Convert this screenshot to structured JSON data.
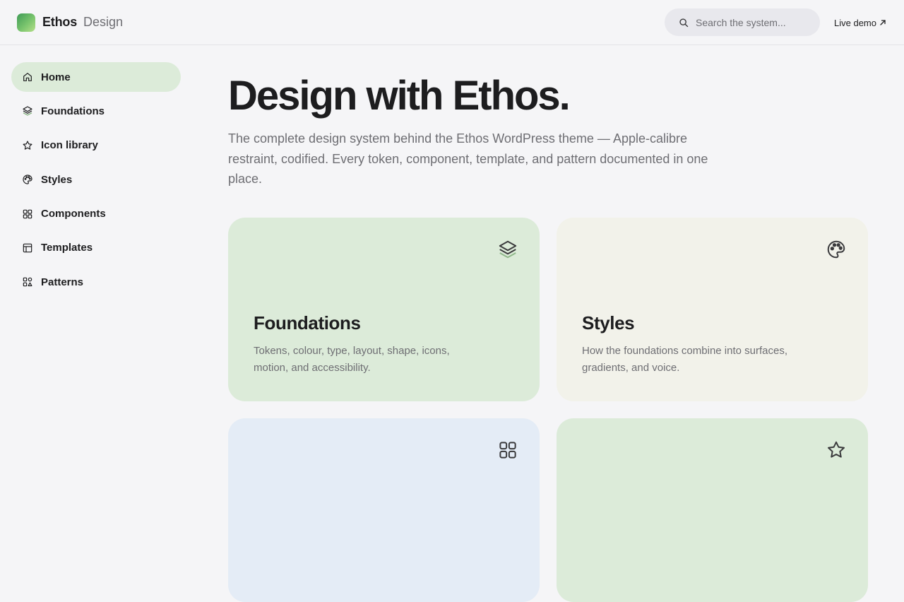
{
  "header": {
    "brand_name": "Ethos",
    "brand_sub": "Design",
    "search_placeholder": "Search the system...",
    "live_demo_label": "Live demo"
  },
  "sidebar": {
    "items": [
      {
        "label": "Home",
        "icon": "home-icon",
        "active": true
      },
      {
        "label": "Foundations",
        "icon": "layers-icon"
      },
      {
        "label": "Icon library",
        "icon": "star-icon"
      },
      {
        "label": "Styles",
        "icon": "palette-icon"
      },
      {
        "label": "Components",
        "icon": "grid-icon"
      },
      {
        "label": "Templates",
        "icon": "layout-icon"
      },
      {
        "label": "Patterns",
        "icon": "shapes-icon"
      }
    ]
  },
  "hero": {
    "title": "Design with Ethos.",
    "description": "The complete design system behind the Ethos WordPress theme — Apple-calibre restraint, codified. Every token, component, template, and pattern documented in one place."
  },
  "cards": [
    {
      "title": "Foundations",
      "description": "Tokens, colour, type, layout, shape, icons, motion, and accessibility.",
      "icon": "layers-icon",
      "bg": "#dcebd9"
    },
    {
      "title": "Styles",
      "description": "How the foundations combine into surfaces, gradients, and voice.",
      "icon": "palette-icon",
      "bg": "#f2f2ea"
    },
    {
      "title": "",
      "description": "",
      "icon": "grid-icon",
      "bg": "#e4ecf6"
    },
    {
      "title": "",
      "description": "",
      "icon": "star-icon",
      "bg": "#dcebd9"
    }
  ],
  "colors": {
    "accent_green": "#dcebd9",
    "text_primary": "#1d1d1f",
    "text_secondary": "#6e6e73",
    "page_bg": "#f5f5f7"
  }
}
